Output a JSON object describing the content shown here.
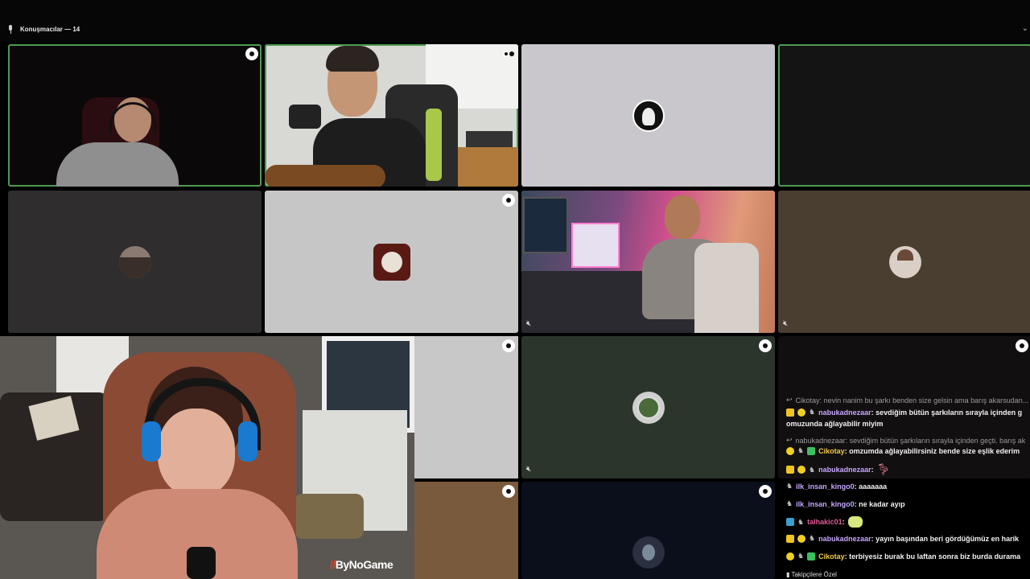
{
  "header": {
    "speakers_label": "Konuşmacılar — 14",
    "chevron_icon": "chevron-down-icon"
  },
  "tiles": [
    {
      "id": "cam-1",
      "kind": "camera",
      "speaking": true,
      "gear": true
    },
    {
      "id": "cam-2",
      "kind": "camera",
      "speaking": true,
      "gear": true
    },
    {
      "id": "user-3",
      "kind": "avatar",
      "bg": "#c9c7cc",
      "gear": false
    },
    {
      "id": "user-4",
      "kind": "empty",
      "bg": "#141414",
      "speaking": true
    },
    {
      "id": "user-5",
      "kind": "avatar",
      "bg": "#2f2d2e"
    },
    {
      "id": "user-6",
      "kind": "avatar",
      "bg": "#c6c6c6",
      "gear": true
    },
    {
      "id": "cam-7",
      "kind": "camera",
      "muted": true
    },
    {
      "id": "user-8",
      "kind": "avatar",
      "bg": "#4a3e30",
      "muted": true
    },
    {
      "id": "cam-9",
      "kind": "camera"
    },
    {
      "id": "user-10",
      "kind": "blank",
      "bg": "#c8c8c8",
      "gear": true
    },
    {
      "id": "user-11",
      "kind": "avatar",
      "bg": "#2b352b",
      "gear": true,
      "muted": true
    },
    {
      "id": "user-12",
      "kind": "chat",
      "bg": "#120f10",
      "gear": true
    },
    {
      "id": "user-13",
      "kind": "blank",
      "bg": "#7a5a3c",
      "gear": true
    },
    {
      "id": "user-14",
      "kind": "avatar",
      "bg": "#0b0f1c",
      "gear": true
    }
  ],
  "watermark": {
    "slash": "//",
    "text": "ByNoGame"
  },
  "chat": {
    "messages": [
      {
        "reply": true,
        "text": "Cikotay: nevin nanim bu şarkı benden size gelsin ama barış akarsudan..."
      },
      {
        "name": "nabukadnezaar",
        "color": "#c7a6ff",
        "text": ": sevdiğim bütün şarkıların sırayla içinden g",
        "cont": "omuzunda ağlayabilir miyim"
      },
      {
        "reply": true,
        "text": "nabukadnezaar: sevdiğim bütün şarkıların sırayla içinden geçti. barış ak"
      },
      {
        "name": "Cikotay",
        "color": "#f0c94a",
        "text": ": omzumda ağlayabilirsiniz bende size eşlik ederim"
      },
      {
        "name": "nabukadnezaar",
        "color": "#c7a6ff",
        "text": ":"
      },
      {
        "name": "ilk_insan_kingo0",
        "color": "#c7a6ff",
        "text": ": aaaaaaa"
      },
      {
        "name": "ilk_insan_kingo0",
        "color": "#c7a6ff",
        "text": ": ne kadar ayıp"
      },
      {
        "name": "talhakic01",
        "color": "#e05a9a",
        "text": ":"
      },
      {
        "name": "nabukadnezaar",
        "color": "#c7a6ff",
        "text": ": yayın başından beri gördüğümüz en harik"
      },
      {
        "name": "Cikotay",
        "color": "#f0c94a",
        "text": ": terbiyesiz burak bu laftan sonra biz burda durama"
      }
    ],
    "footer": "Takipçilere Özel"
  }
}
